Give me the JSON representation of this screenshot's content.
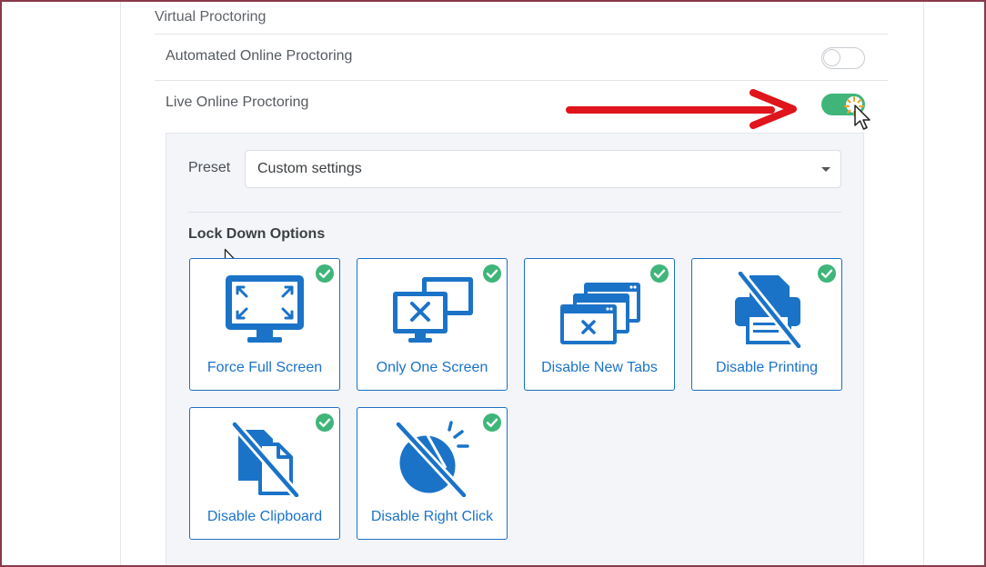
{
  "section": {
    "title": "Virtual Proctoring"
  },
  "rows": [
    {
      "label": "Automated Online Proctoring",
      "enabled": false
    },
    {
      "label": "Live Online Proctoring",
      "enabled": true
    }
  ],
  "preset": {
    "label": "Preset",
    "value": "Custom settings"
  },
  "lockdown": {
    "title": "Lock Down Options",
    "options": [
      {
        "label": "Force Full Screen",
        "checked": true,
        "icon": "fullscreen-monitor-icon"
      },
      {
        "label": "Only One Screen",
        "checked": true,
        "icon": "multi-monitor-icon"
      },
      {
        "label": "Disable New Tabs",
        "checked": true,
        "icon": "browser-tabs-icon"
      },
      {
        "label": "Disable Printing",
        "checked": true,
        "icon": "printer-disabled-icon"
      },
      {
        "label": "Disable Clipboard",
        "checked": true,
        "icon": "clipboard-disabled-icon"
      },
      {
        "label": "Disable Right Click",
        "checked": true,
        "icon": "mouse-disabled-icon"
      }
    ]
  },
  "colors": {
    "accent_blue": "#1b73c8",
    "toggle_on": "#3fb57a",
    "check_green": "#3fb57a",
    "arrow_red": "#e0141b"
  }
}
